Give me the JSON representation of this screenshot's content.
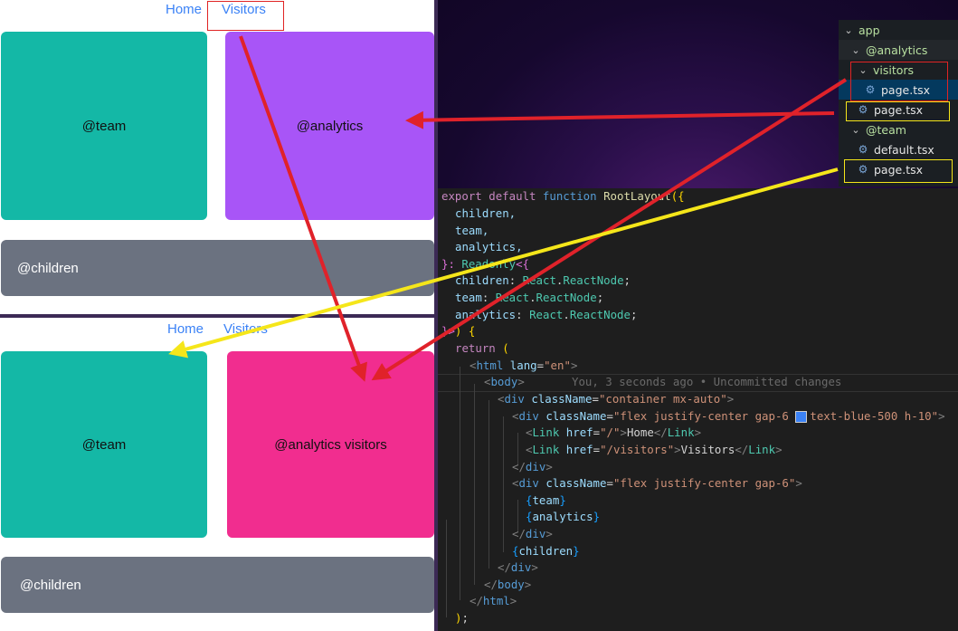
{
  "nav": {
    "home": "Home",
    "visitors": "Visitors"
  },
  "top_view": {
    "team": "@team",
    "analytics": "@analytics",
    "children": "@children"
  },
  "bottom_view": {
    "team": "@team",
    "analytics": "@analytics visitors",
    "children": "@children"
  },
  "explorer": {
    "items": [
      {
        "label": "app",
        "type": "folder"
      },
      {
        "label": "@analytics",
        "type": "folder"
      },
      {
        "label": "visitors",
        "type": "folder"
      },
      {
        "label": "page.tsx",
        "type": "file"
      },
      {
        "label": "page.tsx",
        "type": "file"
      },
      {
        "label": "@team",
        "type": "folder"
      },
      {
        "label": "default.tsx",
        "type": "file"
      },
      {
        "label": "page.tsx",
        "type": "file"
      }
    ]
  },
  "code": {
    "l1": {
      "a": "export",
      "b": "default",
      "c": "function",
      "d": "RootLayout",
      "e": "({"
    },
    "children": "children,",
    "team": "team,",
    "analytics": "analytics,",
    "l5": {
      "a": "}: ",
      "b": "Readonly",
      "c": "<{"
    },
    "l6": {
      "a": "children",
      "b": ": ",
      "c": "React",
      "d": ".",
      "e": "ReactNode",
      "f": ";"
    },
    "l7": {
      "a": "team",
      "b": ": ",
      "c": "React",
      "d": ".",
      "e": "ReactNode",
      "f": ";"
    },
    "l8": {
      "a": "analytics",
      "b": ": ",
      "c": "React",
      "d": ".",
      "e": "ReactNode",
      "f": ";"
    },
    "l9": {
      "a": "}>",
      "b": ") {"
    },
    "l10": {
      "a": "return",
      "b": "("
    },
    "l11": {
      "a": "<",
      "b": "html",
      "c": "lang",
      "d": "=",
      "e": "\"en\"",
      "f": ">"
    },
    "l12": {
      "a": "<",
      "b": "body",
      "c": ">"
    },
    "blame": "You, 3 seconds ago • Uncommitted changes",
    "l13": {
      "a": "<",
      "b": "div",
      "c": "className",
      "d": "=",
      "e": "\"container mx-auto\"",
      "f": ">"
    },
    "l14": {
      "a": "<",
      "b": "div",
      "c": "className",
      "d": "=",
      "e": "\"flex justify-center gap-6 ",
      "f": "text-blue-500 h-10\"",
      "g": ">"
    },
    "l15": {
      "a": "<",
      "b": "Link",
      "c": "href",
      "d": "=",
      "e": "\"/\"",
      "f": ">",
      "g": "Home",
      "h": "</",
      "i": "Link",
      "j": ">"
    },
    "l16": {
      "a": "<",
      "b": "Link",
      "c": "href",
      "d": "=",
      "e": "\"/visitors\"",
      "f": ">",
      "g": "Visitors",
      "h": "</",
      "i": "Link",
      "j": ">"
    },
    "l17": {
      "a": "</",
      "b": "div",
      "c": ">"
    },
    "l18": {
      "a": "<",
      "b": "div",
      "c": "className",
      "d": "=",
      "e": "\"flex justify-center gap-6\"",
      "f": ">"
    },
    "l19": {
      "a": "{",
      "b": "team",
      "c": "}"
    },
    "l20": {
      "a": "{",
      "b": "analytics",
      "c": "}"
    },
    "l21": {
      "a": "</",
      "b": "div",
      "c": ">"
    },
    "l22": {
      "a": "{",
      "b": "children",
      "c": "}"
    },
    "l23": {
      "a": "</",
      "b": "div",
      "c": ">"
    },
    "l24": {
      "a": "</",
      "b": "body",
      "c": ">"
    },
    "l25": {
      "a": "</",
      "b": "html",
      "c": ">"
    },
    "l26": {
      "a": ")",
      "b": ";"
    }
  },
  "colors": {
    "team": "#14b8a6",
    "analytics": "#a855f7",
    "visitors": "#f12d8f",
    "children": "#6b7280",
    "link": "#3b82f6",
    "arrow_red": "#e0222a",
    "arrow_yellow": "#f5e61a"
  }
}
